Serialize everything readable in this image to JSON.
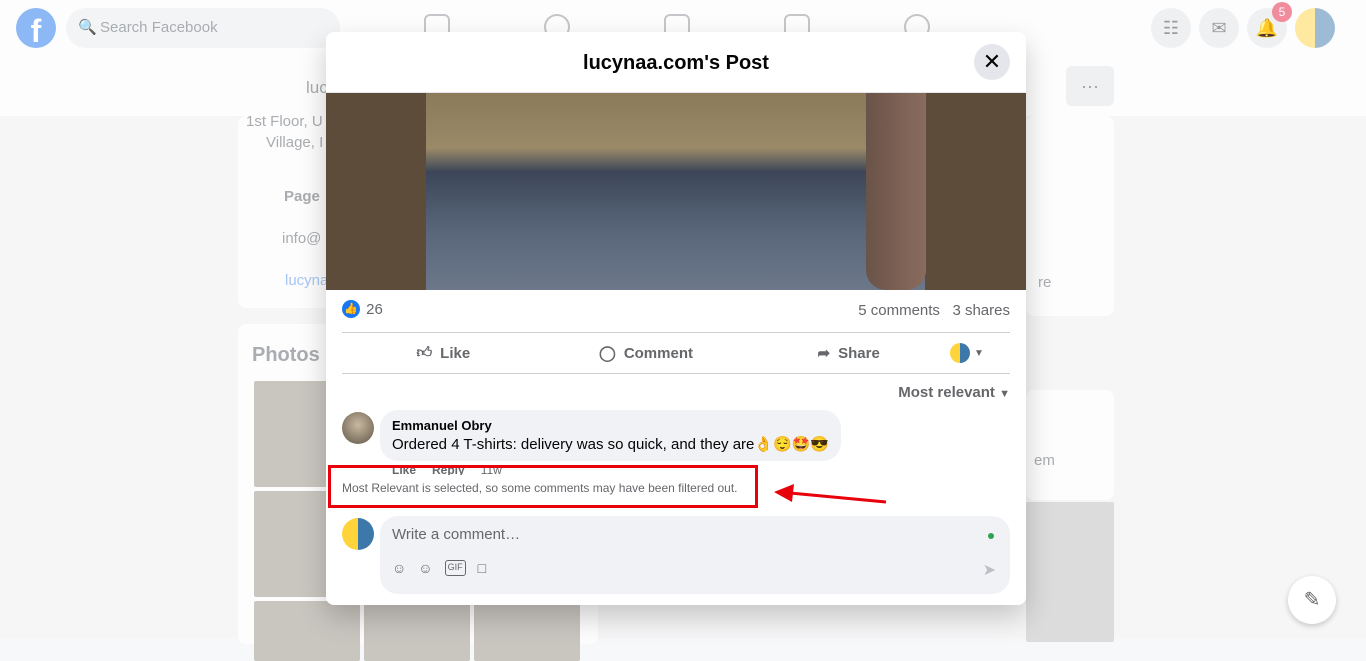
{
  "topbar": {
    "search_placeholder": "Search Facebook",
    "notification_count": "5",
    "logo": "f"
  },
  "background": {
    "page_name": "luc",
    "address_line1": "1st Floor, U",
    "address_line2": "Village, I",
    "page_label": "Page",
    "email": "info@",
    "website": "lucyna",
    "photos_title": "Photos",
    "right_fragment1": "re",
    "right_fragment2": "em"
  },
  "modal": {
    "title": "lucynaa.com's Post",
    "likes": "26",
    "comments": "5 comments",
    "shares": "3 shares",
    "actions": {
      "like": "Like",
      "comment": "Comment",
      "share": "Share"
    },
    "sort_label": "Most relevant",
    "comment": {
      "author": "Emmanuel Obry",
      "text": "Ordered 4 T-shirts: delivery was so quick, and they are👌😌🤩😎",
      "like": "Like",
      "reply": "Reply",
      "time": "11w"
    },
    "filter_notice": "Most Relevant is selected, so some comments may have been filtered out.",
    "compose_placeholder": "Write a comment…"
  },
  "colors": {
    "brand": "#1877f2",
    "highlight": "#e8000b"
  }
}
